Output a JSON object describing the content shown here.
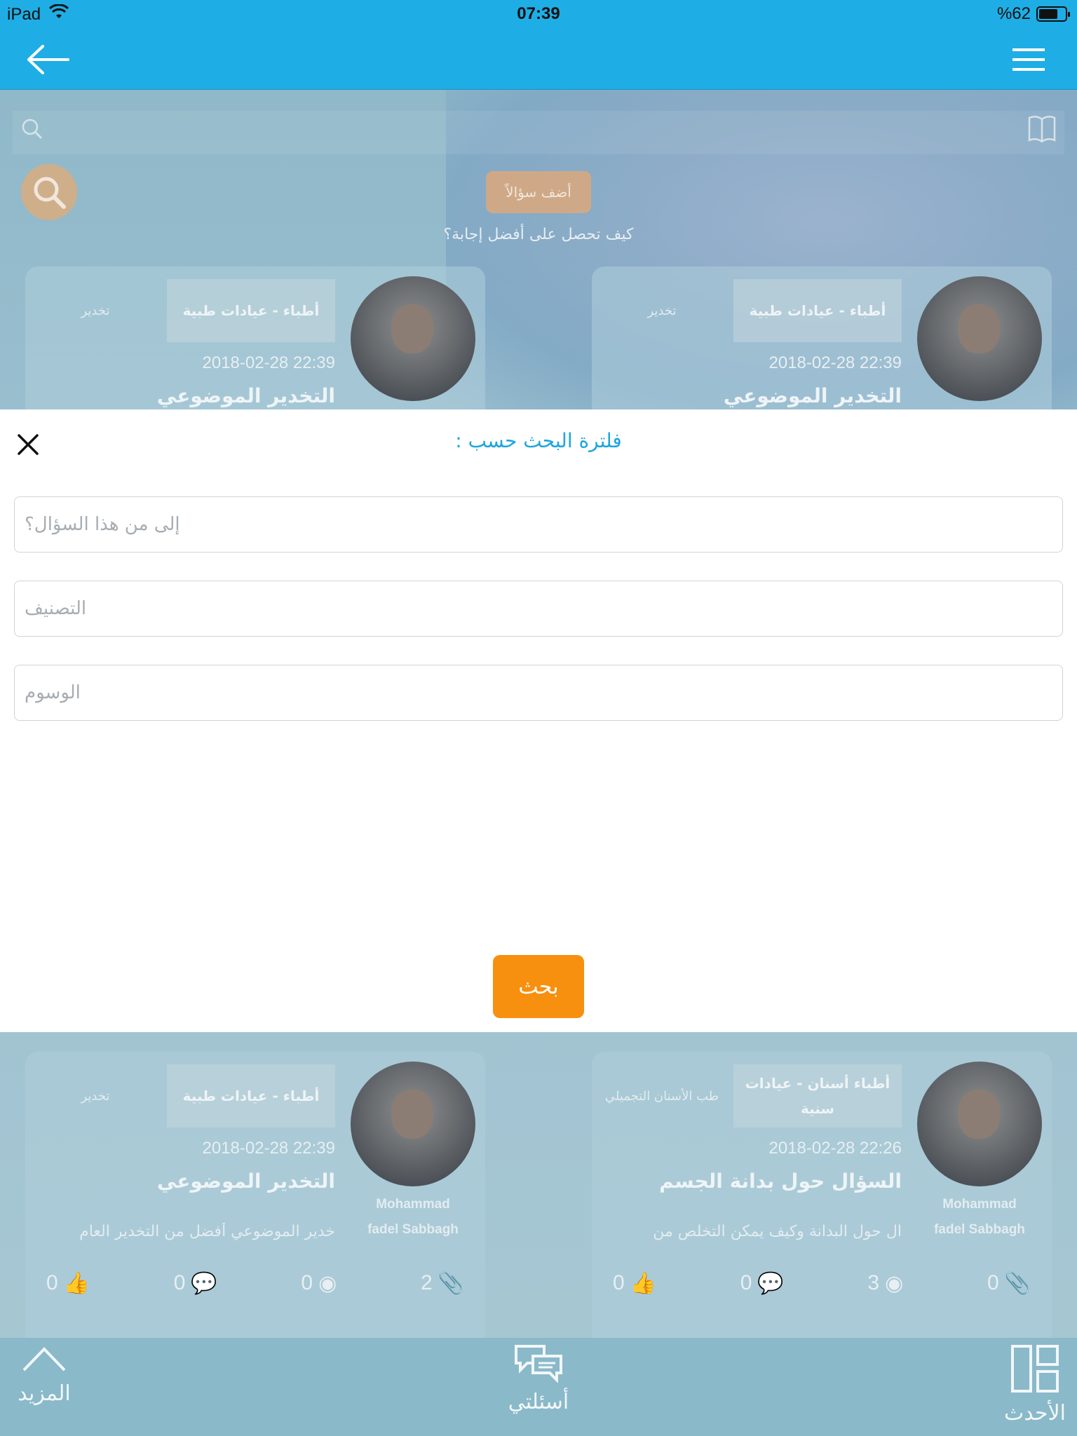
{
  "status_bar": {
    "device": "iPad",
    "time": "07:39",
    "battery": "%62"
  },
  "nav": {
    "back_icon": "arrow-left-icon",
    "menu_icon": "hamburger-menu-icon"
  },
  "background": {
    "add_question": "أضف سؤالاً",
    "how_to": "كيف تحصل على أفضل إجابة؟",
    "cards": [
      {
        "tag": "أطباء - عيادات طبية",
        "subtag": "تخدير",
        "date": "2018-02-28 22:39",
        "title": "التخدير الموضوعي",
        "author_line1": "",
        "author_line2": "",
        "excerpt": "",
        "stats": {
          "likes": "",
          "comments": "",
          "views": "",
          "attachments": ""
        }
      },
      {
        "tag": "أطباء - عيادات طبية",
        "subtag": "تخدير",
        "date": "2018-02-28 22:39",
        "title": "التخدير الموضوعي",
        "author_line1": "",
        "author_line2": "",
        "excerpt": "",
        "stats": {
          "likes": "",
          "comments": "",
          "views": "",
          "attachments": ""
        }
      },
      {
        "tag": "أطباء أسنان - عيادات سنية",
        "subtag": "طب الأسنان التجميلي",
        "date": "2018-02-28 22:26",
        "title": "السؤال حول بدانة الجسم",
        "author_line1": "Mohammad",
        "author_line2": "fadel Sabbagh",
        "excerpt": "ال حول البدانة وكيف يمكن التخلص من",
        "stats": {
          "likes": "0",
          "comments": "0",
          "views": "3",
          "attachments": "0"
        }
      },
      {
        "tag": "أطباء - عيادات طبية",
        "subtag": "تخدير",
        "date": "2018-02-28 22:39",
        "title": "التخدير الموضوعي",
        "author_line1": "Mohammad",
        "author_line2": "fadel Sabbagh",
        "excerpt": "خدير الموضوعي أفضل من التخدير العام",
        "stats": {
          "likes": "0",
          "comments": "0",
          "views": "0",
          "attachments": "2"
        }
      }
    ]
  },
  "modal": {
    "title": "فلترة البحث حسب :",
    "fields": [
      {
        "placeholder": "إلى من هذا السؤال؟",
        "value": ""
      },
      {
        "placeholder": "التصنيف",
        "value": ""
      },
      {
        "placeholder": "الوسوم",
        "value": ""
      }
    ],
    "search_button": "بحث",
    "close_icon": "close-icon"
  },
  "tabbar": {
    "more": "المزيد",
    "mine": "أسئلتي",
    "latest": "الأحدث"
  },
  "colors": {
    "accent": "#1eaee5",
    "button": "#f7900e",
    "title": "#1da5dd"
  }
}
